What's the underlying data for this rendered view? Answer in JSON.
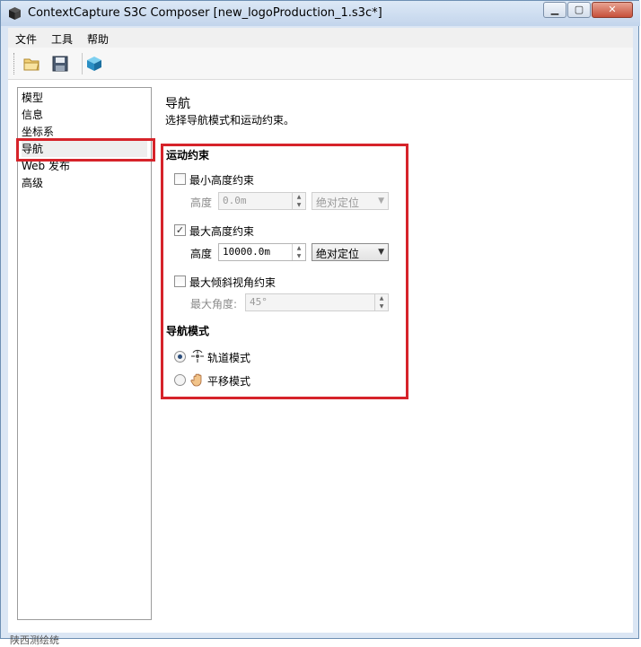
{
  "window": {
    "title": "ContextCapture S3C Composer [new_logoProduction_1.s3c*]",
    "controls": {
      "minimize": "▁",
      "maximize": "▢",
      "close": "✕"
    }
  },
  "menu": {
    "file": "文件",
    "tools": "工具",
    "help": "帮助"
  },
  "toolbar": {
    "icons": [
      "open-folder-icon",
      "save-icon",
      "cube-icon"
    ]
  },
  "sidebar": {
    "items": [
      {
        "label": "模型"
      },
      {
        "label": "信息"
      },
      {
        "label": "坐标系"
      },
      {
        "label": "导航"
      },
      {
        "label": "Web 发布"
      },
      {
        "label": "高级"
      }
    ],
    "selected": "导航"
  },
  "page": {
    "title": "导航",
    "description": "选择导航模式和运动约束。"
  },
  "motion_constraints": {
    "heading": "运动约束",
    "min_height": {
      "label": "最小高度约束",
      "checked": false,
      "height_label": "高度",
      "value": "0.0m",
      "mode": "绝对定位"
    },
    "max_height": {
      "label": "最大高度约束",
      "checked": true,
      "check_mark": "✓",
      "height_label": "高度",
      "value": "10000.0m",
      "mode": "绝对定位"
    },
    "max_tilt": {
      "label": "最大倾斜视角约束",
      "checked": false,
      "angle_label": "最大角度:",
      "value": "45°"
    }
  },
  "navigation_mode": {
    "heading": "导航模式",
    "options": [
      {
        "label": "轨道模式",
        "selected": true,
        "icon": "orbit-icon"
      },
      {
        "label": "平移模式",
        "selected": false,
        "icon": "hand-icon"
      }
    ]
  },
  "colors": {
    "highlight": "#d6232a",
    "titlebar": "#c3d5ec"
  },
  "status_fragment": "陕西测绘统"
}
